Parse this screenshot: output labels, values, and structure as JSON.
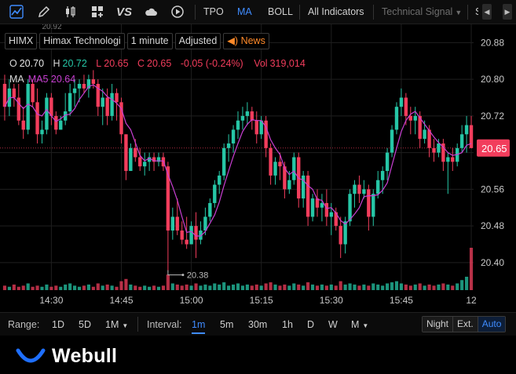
{
  "toolbar": {
    "indicator_buttons": [
      {
        "label": "TPO",
        "active": false
      },
      {
        "label": "MA",
        "active": true
      },
      {
        "label": "BOLL",
        "active": false
      }
    ],
    "all_indicators_label": "All Indicators",
    "technical_signal_label": "Technical Signal",
    "truncated_label": "S",
    "icons": [
      "line-chart-icon",
      "pencil-icon",
      "candlestick-icon",
      "layout-grid-icon",
      "vs-compare-icon",
      "cloud-icon",
      "replay-icon",
      "prev-arrow-icon",
      "next-arrow-icon"
    ],
    "vs_label": "VS",
    "prev_label": "◀",
    "next_label": "▶"
  },
  "legend": {
    "symbol": "HIMX",
    "name": "Himax Technologi",
    "interval": "1 minute",
    "adjust": "Adjusted",
    "news": "News",
    "open_label": "O",
    "open": "20.70",
    "high_label": "H",
    "high": "20.72",
    "low_label": "L",
    "low": "20.65",
    "close_label": "C",
    "close": "20.65",
    "change": "-0.05 (-0.24%)",
    "vol_label": "Vol",
    "vol": "319,014",
    "ma_label": "MA",
    "ma5": "MA5 20.64"
  },
  "range_bar": {
    "range_label": "Range:",
    "ranges": [
      {
        "label": "1D"
      },
      {
        "label": "5D"
      },
      {
        "label": "1M",
        "dropdown": true
      }
    ],
    "interval_label": "Interval:",
    "intervals": [
      {
        "label": "1m",
        "active": true
      },
      {
        "label": "5m"
      },
      {
        "label": "30m"
      },
      {
        "label": "1h"
      },
      {
        "label": "D"
      },
      {
        "label": "W"
      },
      {
        "label": "M",
        "dropdown": true
      }
    ],
    "modes": [
      {
        "label": "Night",
        "active": false
      },
      {
        "label": "Ext.",
        "active": false
      },
      {
        "label": "Auto",
        "active": true
      }
    ]
  },
  "footer": {
    "brand": "Webull"
  },
  "colors": {
    "up": "#26c6a6",
    "down": "#f23d5c",
    "ma": "#c93fd3",
    "accent": "#3f8cff",
    "news": "#ff8a2a",
    "price_tag": "#f23d5c"
  },
  "chart_data": {
    "type": "candlestick",
    "y_ticks": [
      "20.88",
      "20.80",
      "20.72",
      "20.64",
      "20.56",
      "20.48",
      "20.40"
    ],
    "y_tick_values": [
      20.88,
      20.8,
      20.72,
      20.64,
      20.56,
      20.48,
      20.4
    ],
    "x_ticks": [
      {
        "label": "14:30",
        "index": 10
      },
      {
        "label": "14:45",
        "index": 25
      },
      {
        "label": "15:00",
        "index": 40
      },
      {
        "label": "15:15",
        "index": 55
      },
      {
        "label": "15:30",
        "index": 70
      },
      {
        "label": "15:45",
        "index": 85
      },
      {
        "label": "12",
        "index": 100
      }
    ],
    "last_price_tag": "20.65",
    "last_price": 20.65,
    "annotations": [
      {
        "label": "20.38",
        "kind": "low",
        "value": 20.38,
        "index": 35
      },
      {
        "label": "20.92",
        "kind": "high",
        "value": 20.92,
        "index": 8
      }
    ],
    "ylim": [
      20.34,
      20.92
    ],
    "candles": [
      [
        20.79,
        20.81,
        20.71,
        20.74
      ],
      [
        20.74,
        20.8,
        20.72,
        20.78
      ],
      [
        20.78,
        20.79,
        20.74,
        20.76
      ],
      [
        20.76,
        20.79,
        20.7,
        20.71
      ],
      [
        20.71,
        20.74,
        20.67,
        20.69
      ],
      [
        20.69,
        20.8,
        20.68,
        20.79
      ],
      [
        20.79,
        20.8,
        20.74,
        20.75
      ],
      [
        20.75,
        20.78,
        20.66,
        20.68
      ],
      [
        20.68,
        20.71,
        20.66,
        20.69
      ],
      [
        20.69,
        20.77,
        20.68,
        20.76
      ],
      [
        20.76,
        20.77,
        20.7,
        20.72
      ],
      [
        20.72,
        20.73,
        20.68,
        20.69
      ],
      [
        20.69,
        20.72,
        20.69,
        20.71
      ],
      [
        20.71,
        20.77,
        20.7,
        20.73
      ],
      [
        20.73,
        20.79,
        20.72,
        20.77
      ],
      [
        20.77,
        20.8,
        20.74,
        20.78
      ],
      [
        20.78,
        20.8,
        20.75,
        20.79
      ],
      [
        20.79,
        20.81,
        20.77,
        20.78
      ],
      [
        20.78,
        20.81,
        20.76,
        20.8
      ],
      [
        20.8,
        20.82,
        20.78,
        20.79
      ],
      [
        20.79,
        20.8,
        20.72,
        20.74
      ],
      [
        20.74,
        20.78,
        20.7,
        20.76
      ],
      [
        20.76,
        20.78,
        20.7,
        20.72
      ],
      [
        20.72,
        20.79,
        20.71,
        20.77
      ],
      [
        20.77,
        20.78,
        20.71,
        20.75
      ],
      [
        20.75,
        20.76,
        20.66,
        20.68
      ],
      [
        20.68,
        20.68,
        20.58,
        20.6
      ],
      [
        20.6,
        20.66,
        20.6,
        20.65
      ],
      [
        20.65,
        20.67,
        20.62,
        20.63
      ],
      [
        20.63,
        20.65,
        20.6,
        20.61
      ],
      [
        20.61,
        20.64,
        20.59,
        20.62
      ],
      [
        20.62,
        20.64,
        20.6,
        20.63
      ],
      [
        20.63,
        20.64,
        20.6,
        20.62
      ],
      [
        20.62,
        20.64,
        20.61,
        20.63
      ],
      [
        20.63,
        20.64,
        20.6,
        20.61
      ],
      [
        20.61,
        20.62,
        20.38,
        20.47
      ],
      [
        20.47,
        20.52,
        20.45,
        20.5
      ],
      [
        20.5,
        20.54,
        20.46,
        20.47
      ],
      [
        20.47,
        20.49,
        20.44,
        20.45
      ],
      [
        20.45,
        20.5,
        20.43,
        20.44
      ],
      [
        20.44,
        20.49,
        20.44,
        20.48
      ],
      [
        20.48,
        20.51,
        20.41,
        20.45
      ],
      [
        20.45,
        20.49,
        20.44,
        20.47
      ],
      [
        20.47,
        20.52,
        20.46,
        20.5
      ],
      [
        20.5,
        20.54,
        20.49,
        20.53
      ],
      [
        20.53,
        20.58,
        20.52,
        20.57
      ],
      [
        20.57,
        20.6,
        20.55,
        20.59
      ],
      [
        20.59,
        20.66,
        20.58,
        20.65
      ],
      [
        20.65,
        20.68,
        20.62,
        20.66
      ],
      [
        20.66,
        20.7,
        20.64,
        20.69
      ],
      [
        20.69,
        20.73,
        20.67,
        20.71
      ],
      [
        20.71,
        20.74,
        20.69,
        20.72
      ],
      [
        20.72,
        20.75,
        20.7,
        20.73
      ],
      [
        20.73,
        20.74,
        20.69,
        20.71
      ],
      [
        20.71,
        20.73,
        20.66,
        20.68
      ],
      [
        20.68,
        20.72,
        20.67,
        20.71
      ],
      [
        20.71,
        20.72,
        20.63,
        20.65
      ],
      [
        20.65,
        20.66,
        20.57,
        20.59
      ],
      [
        20.59,
        20.63,
        20.57,
        20.62
      ],
      [
        20.62,
        20.64,
        20.58,
        20.61
      ],
      [
        20.61,
        20.62,
        20.54,
        20.56
      ],
      [
        20.56,
        20.6,
        20.55,
        20.58
      ],
      [
        20.58,
        20.64,
        20.57,
        20.63
      ],
      [
        20.63,
        20.64,
        20.52,
        20.54
      ],
      [
        20.54,
        20.6,
        20.52,
        20.59
      ],
      [
        20.59,
        20.6,
        20.48,
        20.5
      ],
      [
        20.5,
        20.55,
        20.49,
        20.54
      ],
      [
        20.54,
        20.56,
        20.5,
        20.52
      ],
      [
        20.52,
        20.55,
        20.49,
        20.53
      ],
      [
        20.53,
        20.56,
        20.48,
        20.5
      ],
      [
        20.5,
        20.53,
        20.46,
        20.51
      ],
      [
        20.51,
        20.52,
        20.47,
        20.48
      ],
      [
        20.48,
        20.5,
        20.41,
        20.44
      ],
      [
        20.44,
        20.5,
        20.42,
        20.49
      ],
      [
        20.49,
        20.56,
        20.48,
        20.55
      ],
      [
        20.55,
        20.58,
        20.52,
        20.57
      ],
      [
        20.57,
        20.59,
        20.53,
        20.55
      ],
      [
        20.55,
        20.58,
        20.54,
        20.56
      ],
      [
        20.56,
        20.57,
        20.47,
        20.5
      ],
      [
        20.5,
        20.56,
        20.48,
        20.55
      ],
      [
        20.55,
        20.6,
        20.54,
        20.58
      ],
      [
        20.58,
        20.61,
        20.55,
        20.6
      ],
      [
        20.6,
        20.65,
        20.58,
        20.64
      ],
      [
        20.64,
        20.7,
        20.63,
        20.69
      ],
      [
        20.69,
        20.75,
        20.68,
        20.74
      ],
      [
        20.74,
        20.78,
        20.72,
        20.76
      ],
      [
        20.76,
        20.77,
        20.7,
        20.72
      ],
      [
        20.72,
        20.74,
        20.68,
        20.71
      ],
      [
        20.71,
        20.74,
        20.68,
        20.72
      ],
      [
        20.72,
        20.73,
        20.65,
        20.67
      ],
      [
        20.67,
        20.71,
        20.66,
        20.69
      ],
      [
        20.69,
        20.7,
        20.63,
        20.65
      ],
      [
        20.65,
        20.67,
        20.62,
        20.64
      ],
      [
        20.64,
        20.67,
        20.63,
        20.66
      ],
      [
        20.66,
        20.67,
        20.6,
        20.62
      ],
      [
        20.62,
        20.64,
        20.55,
        20.63
      ],
      [
        20.63,
        20.65,
        20.6,
        20.62
      ],
      [
        20.62,
        20.66,
        20.61,
        20.65
      ],
      [
        20.65,
        20.7,
        20.64,
        20.68
      ],
      [
        20.68,
        20.72,
        20.64,
        20.7
      ],
      [
        20.7,
        20.72,
        20.65,
        20.65
      ]
    ],
    "volumes": [
      4,
      3,
      5,
      3,
      4,
      6,
      3,
      4,
      3,
      5,
      3,
      4,
      3,
      5,
      6,
      4,
      3,
      4,
      5,
      3,
      6,
      4,
      5,
      4,
      3,
      8,
      10,
      5,
      4,
      3,
      4,
      3,
      4,
      3,
      4,
      14,
      6,
      5,
      4,
      5,
      4,
      6,
      4,
      5,
      4,
      6,
      5,
      7,
      4,
      5,
      6,
      4,
      5,
      4,
      5,
      4,
      6,
      7,
      5,
      4,
      5,
      4,
      6,
      5,
      4,
      7,
      5,
      4,
      5,
      4,
      5,
      4,
      8,
      5,
      6,
      5,
      4,
      5,
      4,
      6,
      5,
      4,
      6,
      7,
      8,
      6,
      5,
      4,
      5,
      6,
      4,
      5,
      4,
      5,
      6,
      5,
      4,
      6,
      9,
      12,
      38
    ]
  }
}
